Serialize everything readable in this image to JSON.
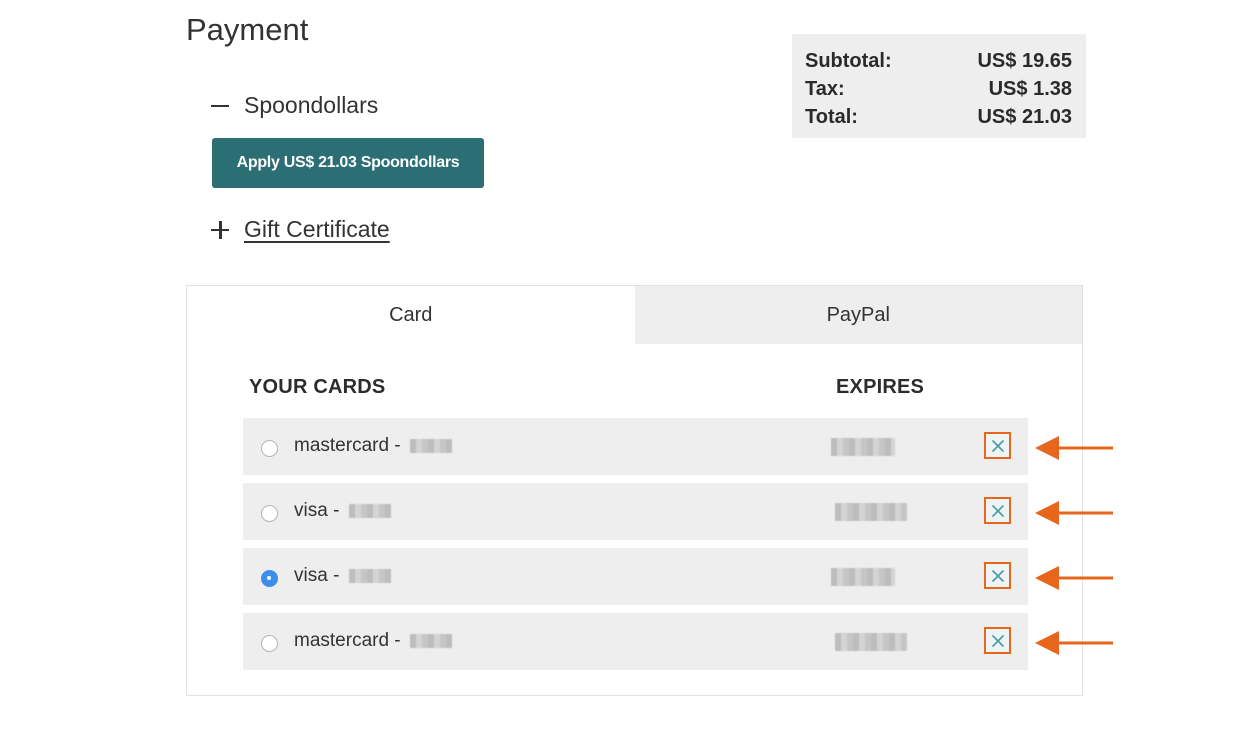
{
  "page": {
    "title": "Payment"
  },
  "spoondollars": {
    "label": "Spoondollars",
    "apply_button": "Apply US$ 21.03 Spoondollars"
  },
  "gift_certificate": {
    "label": "Gift Certificate"
  },
  "summary": {
    "subtotal_label": "Subtotal:",
    "subtotal_value": "US$ 19.65",
    "tax_label": "Tax:",
    "tax_value": "US$ 1.38",
    "total_label": "Total:",
    "total_value": "US$ 21.03"
  },
  "tabs": [
    {
      "label": "Card",
      "active": true
    },
    {
      "label": "PayPal",
      "active": false
    }
  ],
  "cards": {
    "header_cards": "YOUR CARDS",
    "header_expires": "EXPIRES",
    "items": [
      {
        "name": "mastercard -",
        "selected": false
      },
      {
        "name": "visa -",
        "selected": false
      },
      {
        "name": "visa -",
        "selected": true
      },
      {
        "name": "mastercard -",
        "selected": false
      }
    ]
  },
  "colors": {
    "accent": "#2b6f75",
    "highlight": "#e8661c",
    "radio_selected": "#3b8eea"
  }
}
